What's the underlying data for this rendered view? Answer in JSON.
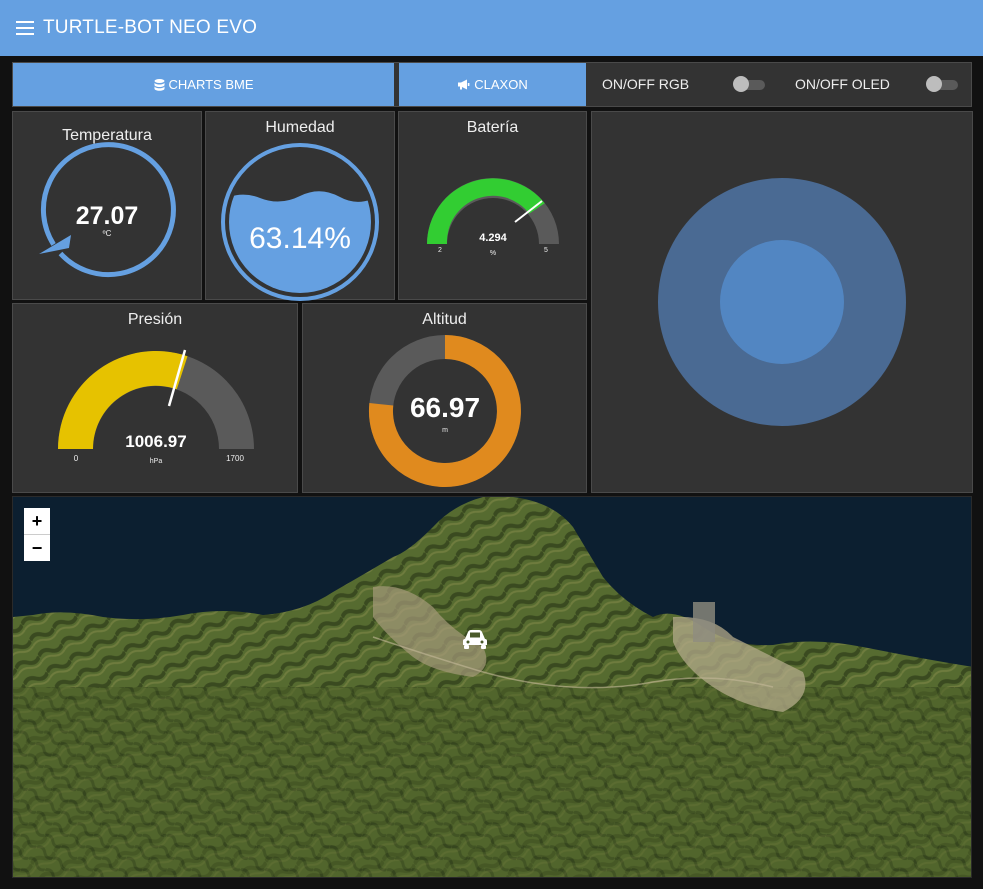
{
  "header": {
    "title": "TURTLE-BOT NEO EVO",
    "menu_icon": "hamburger-menu-icon"
  },
  "controls": {
    "charts_button": {
      "label": "CHARTS BME",
      "icon": "database-icon"
    },
    "claxon_button": {
      "label": "CLAXON",
      "icon": "bullhorn-icon"
    },
    "toggle_rgb": {
      "label": "ON/OFF RGB",
      "on": false
    },
    "toggle_oled": {
      "label": "ON/OFF OLED",
      "on": false
    }
  },
  "gauges": {
    "temperature": {
      "title": "Temperatura",
      "value": "27.07",
      "unit": "ºC",
      "color": "#65a0e1"
    },
    "humidity": {
      "title": "Humedad",
      "value": "63.14%",
      "level": 0.6314,
      "color": "#65a0e1"
    },
    "battery": {
      "title": "Batería",
      "value": "4.294",
      "unit": "%",
      "min": "2",
      "max": "5",
      "color": "#32cd32"
    },
    "pressure": {
      "title": "Presión",
      "value": "1006.97",
      "unit": "hPa",
      "min": "0",
      "max": "1700",
      "color": "#e6c200"
    },
    "altitude": {
      "title": "Altitud",
      "value": "66.97",
      "unit": "m",
      "color": "#e08a1e"
    }
  },
  "map": {
    "zoom_in": "+",
    "zoom_out": "−",
    "marker_icon": "car-icon"
  }
}
